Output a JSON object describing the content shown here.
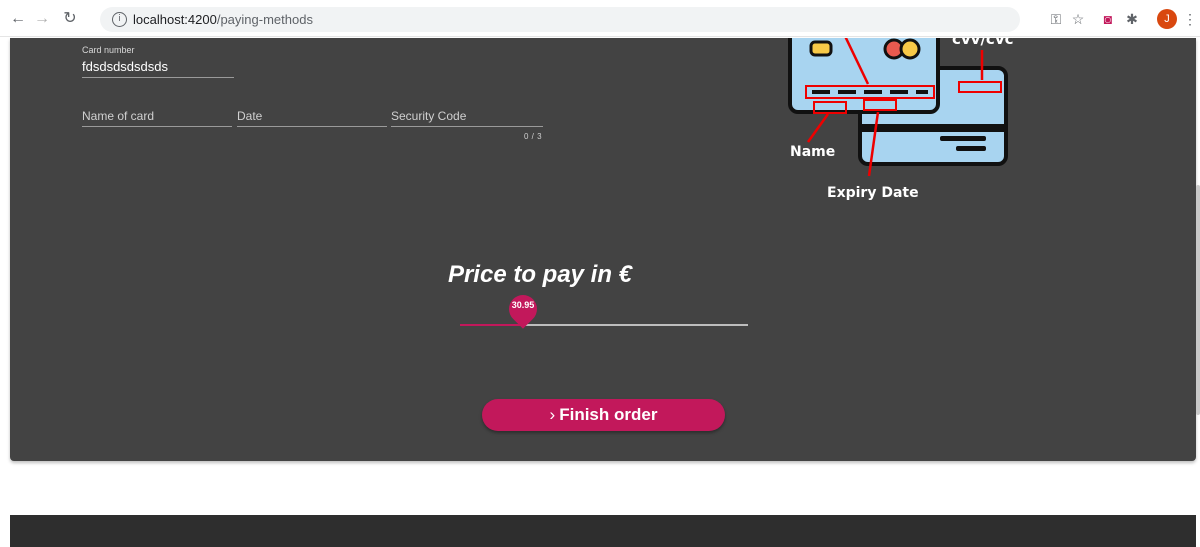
{
  "browser": {
    "url_host": "localhost:4200",
    "url_path": "/paying-methods",
    "avatar_initial": "J"
  },
  "form": {
    "card_number_label": "Card number",
    "card_number_value": "fdsdsdsdsdsds",
    "name_placeholder": "Name of card",
    "date_placeholder": "Date",
    "security_placeholder": "Security Code",
    "security_counter": "0 / 3"
  },
  "illustration": {
    "cvv_label": "cvv/cvc",
    "name_label": "Name",
    "expiry_label": "Expiry Date"
  },
  "price": {
    "title": "Price to pay in €",
    "value_label": "30.95",
    "fill_fraction": 0.22
  },
  "actions": {
    "finish_chevron": "›",
    "finish_label": "Finish order"
  },
  "colors": {
    "accent": "#c2185b",
    "panel": "#434343",
    "footer": "#2e2e2e"
  }
}
